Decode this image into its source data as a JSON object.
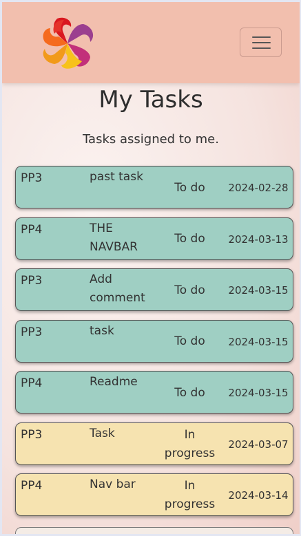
{
  "header": {
    "logo_icon": "swirl-logo-icon",
    "menu_icon": "hamburger-menu-icon"
  },
  "page": {
    "title": "My Tasks",
    "subtitle": "Tasks assigned to me."
  },
  "colors": {
    "navbar": "#f2bfae",
    "todo_card": "#9fcfc3",
    "in_progress_card": "#f6e3b0"
  },
  "tasks": [
    {
      "project": "PP3",
      "title": "past task",
      "status": "To do",
      "due": "2024-02-28",
      "kind": "todo"
    },
    {
      "project": "PP4",
      "title": "THE NAVBAR",
      "status": "To do",
      "due": "2024-03-13",
      "kind": "todo"
    },
    {
      "project": "PP3",
      "title": "Add comment",
      "status": "To do",
      "due": "2024-03-15",
      "kind": "todo"
    },
    {
      "project": "PP3",
      "title": "task",
      "status": "To do",
      "due": "2024-03-15",
      "kind": "todo"
    },
    {
      "project": "PP4",
      "title": "Readme",
      "status": "To do",
      "due": "2024-03-15",
      "kind": "todo"
    },
    {
      "project": "PP3",
      "title": "Task",
      "status": "In progress",
      "due": "2024-03-07",
      "kind": "progress"
    },
    {
      "project": "PP4",
      "title": "Nav bar",
      "status": "In progress",
      "due": "2024-03-14",
      "kind": "progress"
    }
  ]
}
